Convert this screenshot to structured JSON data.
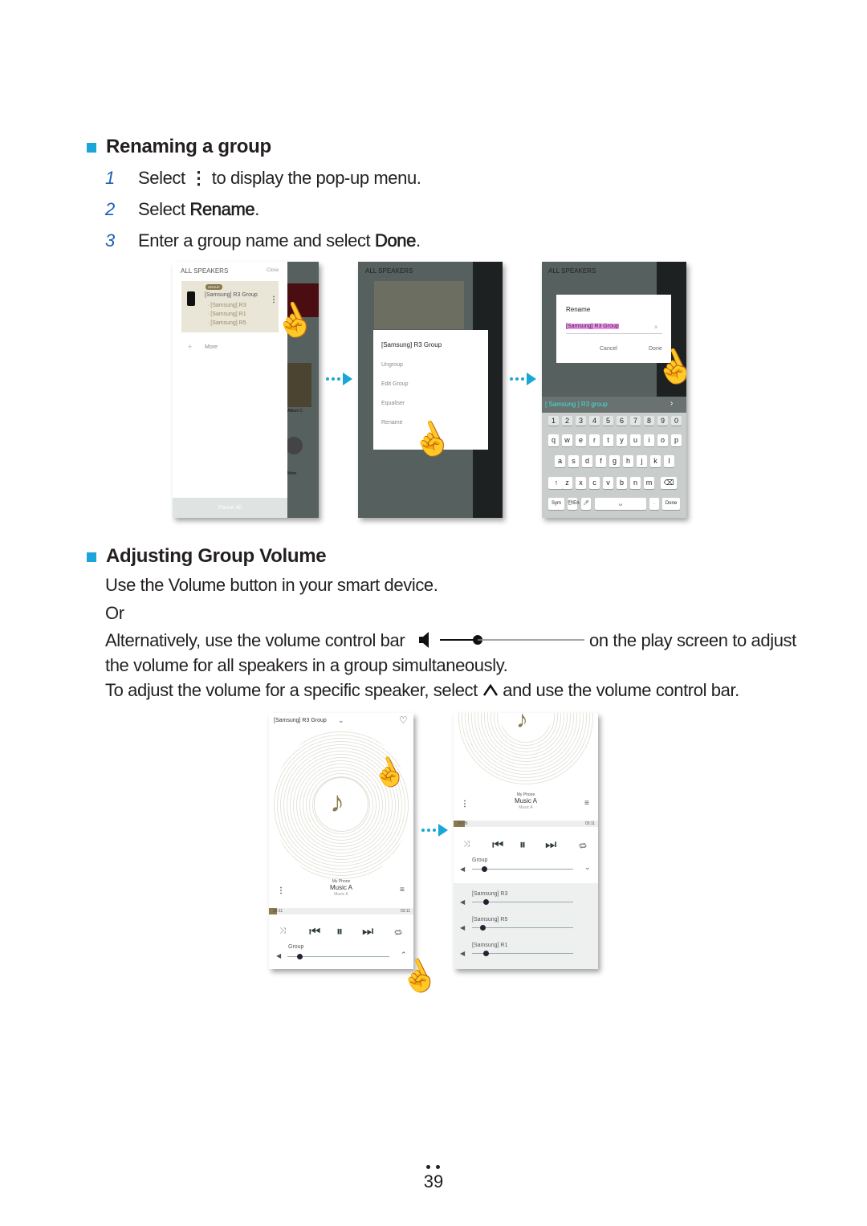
{
  "section1": {
    "title": "Renaming a group",
    "steps": [
      {
        "num": "1",
        "pre": "Select",
        "post": "to display the pop-up menu."
      },
      {
        "num": "2",
        "pre": "Select ",
        "bold": "Rename",
        "post": "."
      },
      {
        "num": "3",
        "pre": "Enter a group name and select ",
        "bold": "Done",
        "post": "."
      }
    ]
  },
  "screen1": {
    "header": "ALL SPEAKERS",
    "close": "Close",
    "badge": "GROUP",
    "group": "[Samsung] R3 Group",
    "members": [
      "· [Samsung] R3",
      "· [Samsung] R1",
      "· [Samsung] R5"
    ],
    "more": "More",
    "pause_all": "Pause All",
    "album": "Album C",
    "more2": "More"
  },
  "screen2": {
    "menu_title": "[Samsung] R3 Group",
    "menu": [
      "Ungroup",
      "Edit Group",
      "Equaliser",
      "Rename"
    ]
  },
  "screen3": {
    "dialog_title": "Rename",
    "input": "[Samsung] R3 Group",
    "cancel": "Cancel",
    "done": "Done",
    "suggestion": "[ Samsung ] R3 group",
    "rows": [
      [
        "1",
        "2",
        "3",
        "4",
        "5",
        "6",
        "7",
        "8",
        "9",
        "0"
      ],
      [
        "q",
        "w",
        "e",
        "r",
        "t",
        "y",
        "u",
        "i",
        "o",
        "p"
      ],
      [
        "a",
        "s",
        "d",
        "f",
        "g",
        "h",
        "j",
        "k",
        "l"
      ],
      [
        "↑",
        "z",
        "x",
        "c",
        "v",
        "b",
        "n",
        "m",
        "⌫"
      ]
    ],
    "sym": "Sym",
    "lang": "한/En",
    "space": "␣",
    "done_key": "Done"
  },
  "section2": {
    "title": "Adjusting Group Volume",
    "line1": "Use the Volume button in your smart device.",
    "line2": "Or",
    "line3a": "Alternatively, use the volume control bar",
    "line3b": "on the play screen to adjust",
    "line4": "the volume for all speakers in a group simultaneously.",
    "line5a": "To adjust the volume for a specific speaker, select",
    "line5b": "and use the volume control bar."
  },
  "player1": {
    "title": "[Samsung] R3 Group",
    "source": "My Phone",
    "track": "Music A",
    "artist": "Music A",
    "elapsed": "00:11",
    "total": "03:11",
    "group": "Group"
  },
  "player2": {
    "source": "My Phone",
    "track": "Music A",
    "artist": "Music A",
    "elapsed": "00:05",
    "total": "03:11",
    "group": "Group",
    "speakers": [
      "[Samsung] R3",
      "[Samsung] R5",
      "[Samsung] R1"
    ]
  },
  "page_number": "39",
  "colors": {
    "accent": "#1aa6d8",
    "step_number": "#1a5fb4",
    "gold": "#8b7a4e"
  }
}
